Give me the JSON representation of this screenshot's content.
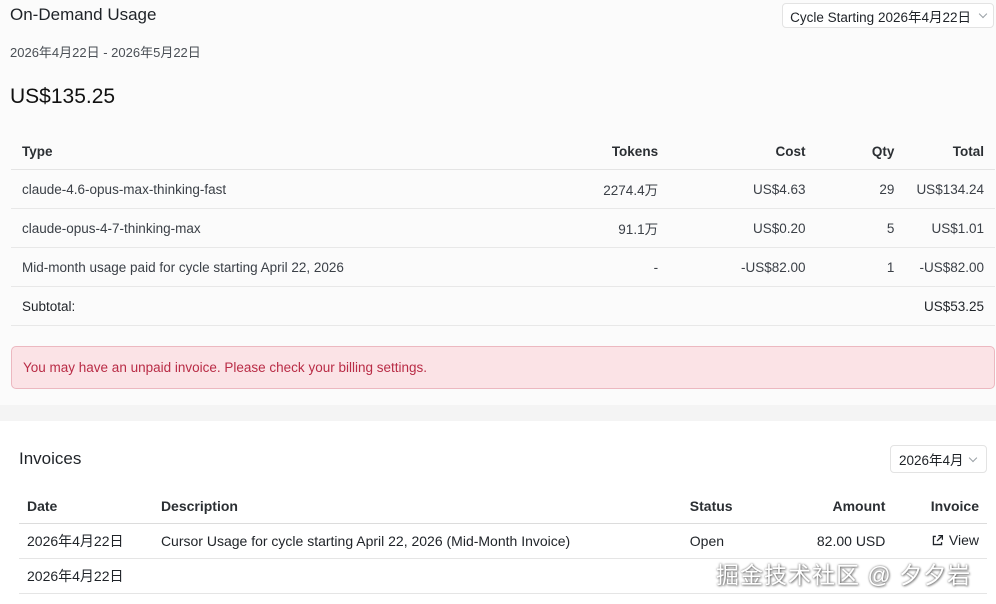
{
  "usage": {
    "title": "On-Demand Usage",
    "cycle_select_value": "Cycle Starting 2026年4月22日",
    "date_range": "2026年4月22日 - 2026年5月22日",
    "total": "US$135.25",
    "columns": {
      "type": "Type",
      "tokens": "Tokens",
      "cost": "Cost",
      "qty": "Qty",
      "total": "Total"
    },
    "rows": [
      {
        "type": "claude-4.6-opus-max-thinking-fast",
        "tokens": "2274.4万",
        "cost": "US$4.63",
        "qty": "29",
        "total": "US$134.24"
      },
      {
        "type": "claude-opus-4-7-thinking-max",
        "tokens": "91.1万",
        "cost": "US$0.20",
        "qty": "5",
        "total": "US$1.01"
      },
      {
        "type": "Mid-month usage paid for cycle starting April 22, 2026",
        "tokens": "-",
        "cost": "-US$82.00",
        "qty": "1",
        "total": "-US$82.00"
      }
    ],
    "subtotal_label": "Subtotal:",
    "subtotal_value": "US$53.25",
    "alert": "You may have an unpaid invoice. Please check your billing settings."
  },
  "invoices": {
    "title": "Invoices",
    "month_select_value": "2026年4月",
    "columns": {
      "date": "Date",
      "description": "Description",
      "status": "Status",
      "amount": "Amount",
      "invoice": "Invoice"
    },
    "rows": [
      {
        "date": "2026年4月22日",
        "description": "Cursor Usage for cycle starting April 22, 2026 (Mid-Month Invoice)",
        "status": "Open",
        "amount": "82.00 USD",
        "link": "View"
      },
      {
        "date": "2026年4月22日",
        "description": "",
        "status": "",
        "amount": "",
        "link": ""
      }
    ]
  },
  "watermark": "掘金技术社区 @ 夕夕岩",
  "colors": {
    "alert_bg": "#fbe3e6",
    "alert_border": "#ecb8c0",
    "alert_text": "#b92c46",
    "section_bg": "#fbfbfb"
  },
  "icons": {
    "select_arrow": "chevron-down-icon",
    "view_link": "external-link-icon"
  }
}
